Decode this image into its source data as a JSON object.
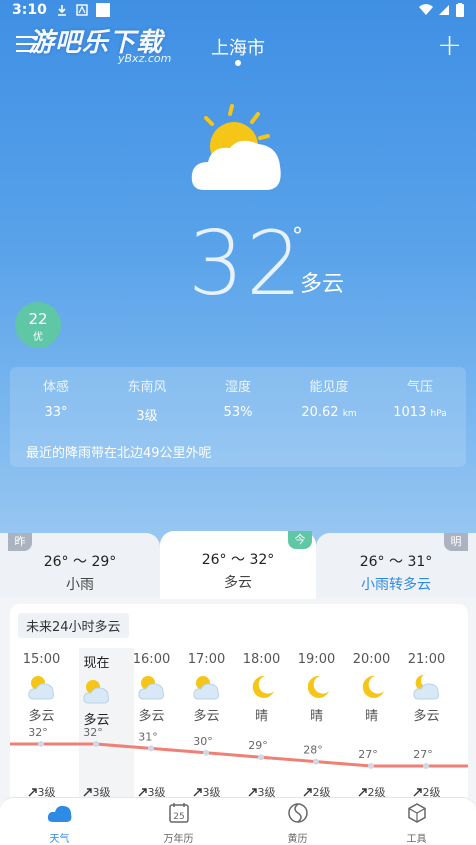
{
  "status_bar": {
    "time": "3:10"
  },
  "watermark": {
    "text": "游吧乐下载",
    "sub": "yBxz.com"
  },
  "header": {
    "city": "上海市"
  },
  "current": {
    "temperature": "32",
    "degree_symbol": "°",
    "condition": "多云",
    "icon": "sun-behind-cloud-icon",
    "aqi": {
      "value": "22",
      "level": "优"
    }
  },
  "details": [
    {
      "label": "体感",
      "value": "33°",
      "unit": ""
    },
    {
      "label": "东南风",
      "value": "3级",
      "unit": ""
    },
    {
      "label": "湿度",
      "value": "53%",
      "unit": ""
    },
    {
      "label": "能见度",
      "value": "20.62",
      "unit": "km"
    },
    {
      "label": "气压",
      "value": "1013",
      "unit": "hPa"
    }
  ],
  "rain_message": "最近的降雨带在北边49公里外呢",
  "days": [
    {
      "tag": "昨",
      "temp": "26° ～ 29°",
      "cond": "小雨"
    },
    {
      "tag": "今",
      "temp": "26° ～ 32°",
      "cond": "多云"
    },
    {
      "tag": "明",
      "temp": "26° ～ 31°",
      "cond": "小雨转多云"
    }
  ],
  "hourly": {
    "title": "未来24小时多云",
    "hours": [
      {
        "time": "15:00",
        "cond": "多云",
        "icon": "partly-cloudy-icon",
        "temp": "32°",
        "wind": "3级"
      },
      {
        "time": "现在",
        "cond": "多云",
        "icon": "partly-cloudy-icon",
        "temp": "32°",
        "wind": "3级"
      },
      {
        "time": "16:00",
        "cond": "多云",
        "icon": "partly-cloudy-icon",
        "temp": "31°",
        "wind": "3级"
      },
      {
        "time": "17:00",
        "cond": "多云",
        "icon": "partly-cloudy-icon",
        "temp": "30°",
        "wind": "3级"
      },
      {
        "time": "18:00",
        "cond": "晴",
        "icon": "moon-icon",
        "temp": "29°",
        "wind": "3级"
      },
      {
        "time": "19:00",
        "cond": "晴",
        "icon": "moon-icon",
        "temp": "28°",
        "wind": "2级"
      },
      {
        "time": "20:00",
        "cond": "晴",
        "icon": "moon-icon",
        "temp": "27°",
        "wind": "2级"
      },
      {
        "time": "21:00",
        "cond": "多云",
        "icon": "partly-cloudy-night-icon",
        "temp": "27°",
        "wind": "2级"
      }
    ]
  },
  "tabs": [
    {
      "label": "天气",
      "icon": "weather-icon",
      "active": true
    },
    {
      "label": "万年历",
      "icon": "calendar-icon",
      "day": "25"
    },
    {
      "label": "黄历",
      "icon": "almanac-icon"
    },
    {
      "label": "工具",
      "icon": "tools-icon"
    }
  ],
  "colors": {
    "accent": "#2d8be6",
    "aqi_good": "#5fc6a6",
    "temp_line": "#f07f75"
  }
}
